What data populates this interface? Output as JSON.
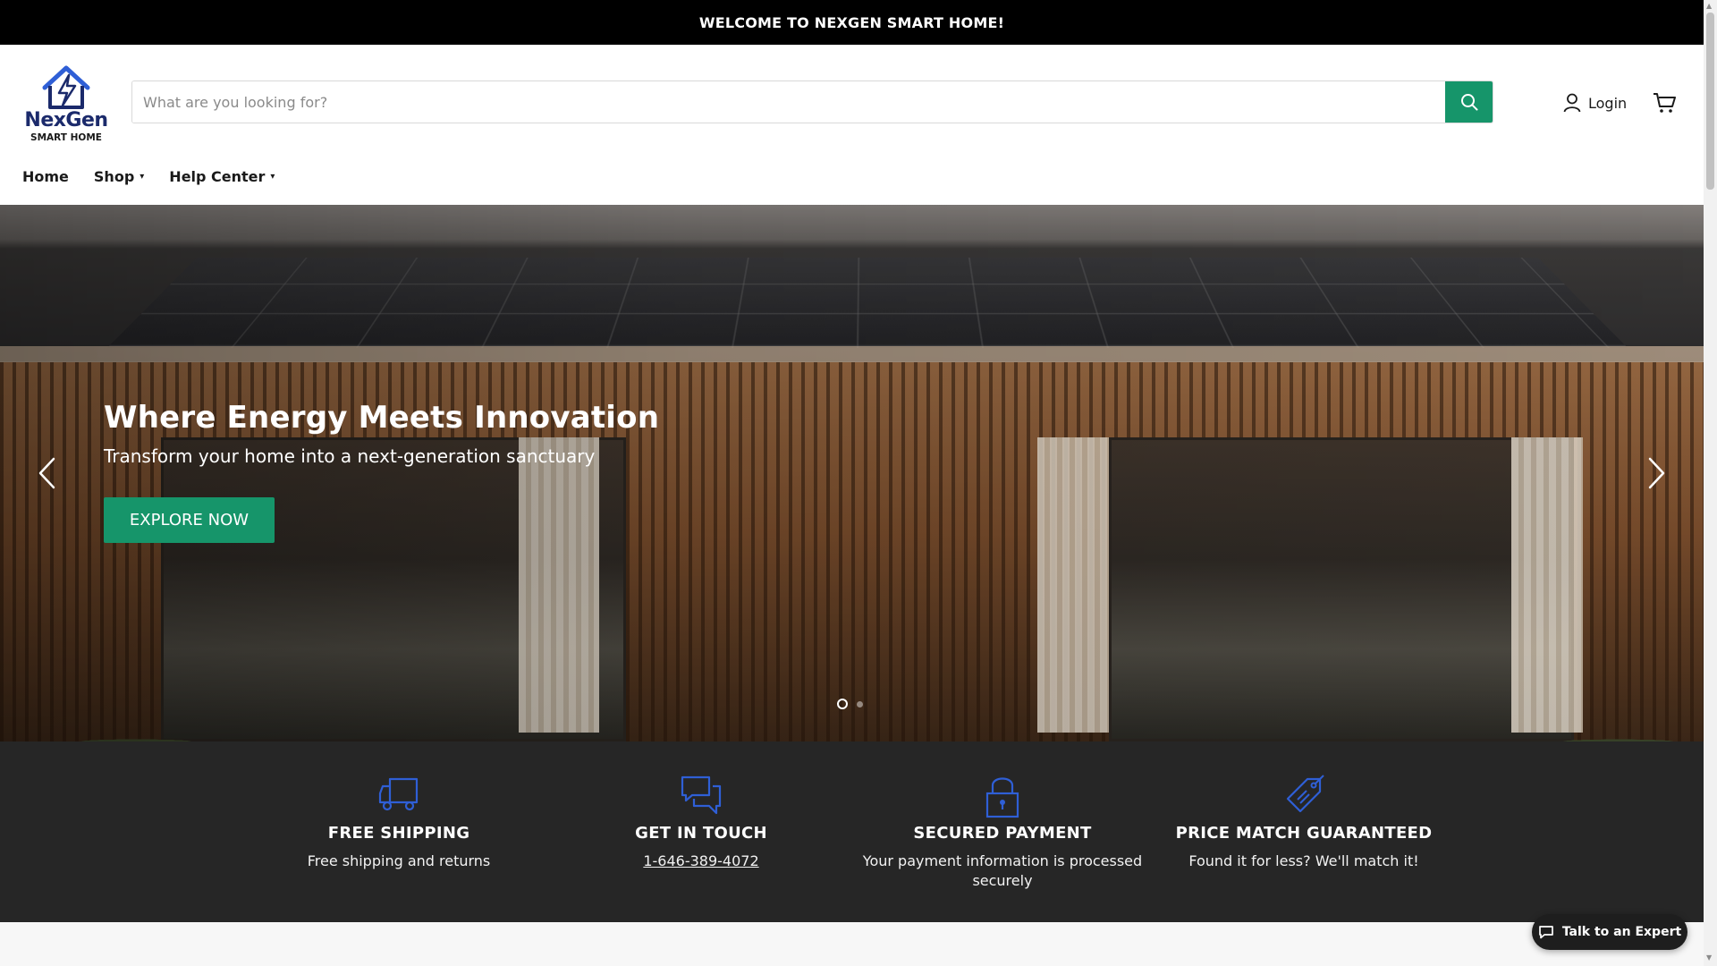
{
  "announcement": {
    "text": "WELCOME TO NEXGEN SMART HOME!"
  },
  "header": {
    "logo": {
      "name": "NexGen",
      "subtitle": "SMART HOME",
      "icon": "house-lightning-icon"
    },
    "search": {
      "placeholder": "What are you looking for?",
      "value": "",
      "button_icon": "search-icon"
    },
    "login_label": "Login",
    "cart_icon": "cart-icon"
  },
  "nav": {
    "items": [
      {
        "label": "Home",
        "has_dropdown": false
      },
      {
        "label": "Shop",
        "has_dropdown": true
      },
      {
        "label": "Help Center",
        "has_dropdown": true
      }
    ]
  },
  "hero": {
    "title": "Where Energy Meets Innovation",
    "subtitle": "Transform your home into a next-generation sanctuary",
    "cta_label": "EXPLORE NOW",
    "slides_total": 2,
    "active_slide": 1
  },
  "features": [
    {
      "icon": "truck-icon",
      "title": "FREE SHIPPING",
      "text": "Free shipping and returns"
    },
    {
      "icon": "chat-bubbles-icon",
      "title": "GET IN TOUCH",
      "text": "1-646-389-4072"
    },
    {
      "icon": "padlock-icon",
      "title": "SECURED PAYMENT",
      "text": "Your payment information is processed securely"
    },
    {
      "icon": "price-tag-icon",
      "title": "PRICE MATCH GUARANTEED",
      "text": "Found it for less? We'll match it!"
    }
  ],
  "chat": {
    "label": "Talk to an Expert",
    "icon": "chat-icon"
  },
  "colors": {
    "accent_green": "#16956a",
    "icon_blue": "#2f5fd6",
    "announcement_bg": "#000000",
    "features_bg": "#262626",
    "logo_navy": "#1b2a6b"
  }
}
